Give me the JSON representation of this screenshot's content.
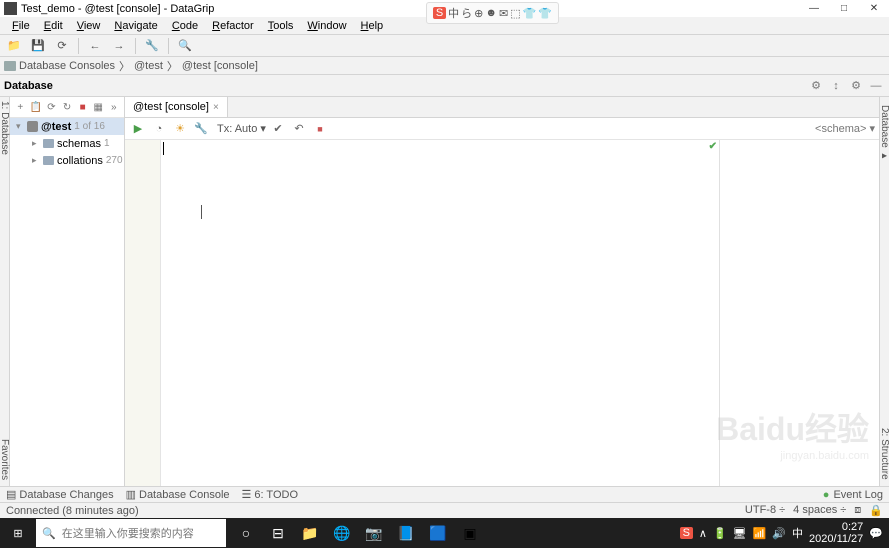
{
  "window": {
    "title": "Test_demo - @test [console] - DataGrip",
    "controls": {
      "min": "—",
      "max": "□",
      "close": "✕"
    }
  },
  "tray_overlay": {
    "items": [
      "中",
      "ら",
      "⊕",
      "☻",
      "✉",
      "⬚",
      "👕",
      "👕"
    ]
  },
  "menubar": [
    "File",
    "Edit",
    "View",
    "Navigate",
    "Code",
    "Refactor",
    "Tools",
    "Window",
    "Help"
  ],
  "toolbar_icons": [
    "folder",
    "save",
    "refresh",
    "back",
    "forward",
    "sep",
    "wrench",
    "sep",
    "search"
  ],
  "breadcrumb": [
    {
      "icon": "folder",
      "label": "Database Consoles"
    },
    {
      "icon": "db",
      "label": "@test"
    },
    {
      "icon": "db",
      "label": "@test [console]"
    }
  ],
  "tool_panel": {
    "title": "Database",
    "buttons": [
      "⚙",
      "↕",
      "⚙",
      "—"
    ]
  },
  "sidebar_rails": {
    "left": [
      "1: Database"
    ],
    "left_bottom": "Favorites",
    "right": [
      "Database ▸",
      "2: Structure"
    ]
  },
  "tree": {
    "toolbar": [
      "+",
      "📋",
      "⟳",
      "↻",
      "■",
      "▦",
      "»"
    ],
    "nodes": [
      {
        "toggle": "▾",
        "icon": "db",
        "label": "@test",
        "count": "1 of 16",
        "bold": true,
        "selected": true,
        "indent": 0
      },
      {
        "toggle": "▸",
        "icon": "fld",
        "label": "schemas",
        "count": "1",
        "indent": 1
      },
      {
        "toggle": "▸",
        "icon": "fld",
        "label": "collations",
        "count": "270",
        "indent": 1
      }
    ]
  },
  "editor": {
    "tab": {
      "icon": "db",
      "label": "@test [console]",
      "close": "×"
    },
    "toolbar": {
      "buttons": [
        {
          "name": "run",
          "glyph": "▶",
          "class": "et-play"
        },
        {
          "name": "clock",
          "glyph": "◔"
        },
        {
          "name": "sun",
          "glyph": "☀",
          "class": "et-sun"
        },
        {
          "name": "wrench",
          "glyph": "🔧"
        }
      ],
      "tx_label": "Tx: Auto ▾",
      "post_buttons": [
        {
          "name": "check",
          "glyph": "✔"
        },
        {
          "name": "undo",
          "glyph": "↶"
        },
        {
          "name": "stop",
          "glyph": "■",
          "class": "et-stop"
        }
      ],
      "right_label": "<schema> ▾"
    },
    "check_mark": "✔"
  },
  "bottom_bar": {
    "left": [
      {
        "icon": "▤",
        "label": "Database Changes"
      },
      {
        "icon": "▥",
        "label": "Database Console"
      },
      {
        "icon": "☰",
        "label": "6: TODO"
      }
    ],
    "right": {
      "icon": "●",
      "label": "Event Log"
    }
  },
  "statusbar": {
    "left": "Connected (8 minutes ago)",
    "right": [
      "UTF-8 ÷",
      "4 spaces ÷",
      "⧈",
      "🔒"
    ]
  },
  "taskbar": {
    "start": "⊞",
    "search_icon": "🔍",
    "search_placeholder": "在这里输入你要搜索的内容",
    "icons": [
      "○",
      "⊟",
      "📁",
      "🌐",
      "📷",
      "📘",
      "🟦",
      "▣"
    ],
    "tray_icons": [
      "S",
      "∧",
      "🔋",
      "🖥",
      "📶",
      "🔊",
      "中"
    ],
    "clock": {
      "time": "0:27",
      "date": "2020/11/27"
    }
  },
  "watermark": {
    "main": "Baidu经验",
    "sub": "jingyan.baidu.com"
  }
}
